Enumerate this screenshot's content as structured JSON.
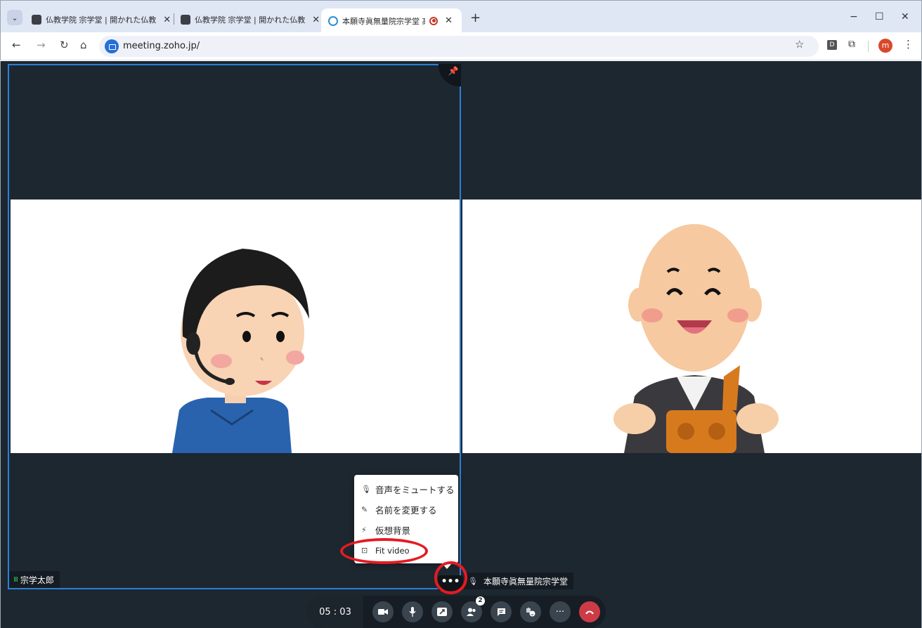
{
  "browser": {
    "tabs": [
      {
        "title": "仏教学院 宗学堂 | 開かれた仏教",
        "close": "✕",
        "active": false
      },
      {
        "title": "仏教学院 宗学堂 | 開かれた仏教",
        "close": "✕",
        "active": false
      },
      {
        "title": "本願寺眞無量院宗学堂  高",
        "close": "✕",
        "active": true
      }
    ],
    "new_tab": "+",
    "window_controls": {
      "minimize": "−",
      "maximize": "☐",
      "close": "✕"
    },
    "address": {
      "url": "meeting.zoho.jp/"
    },
    "extension_d": "D",
    "profile_initial": "m",
    "icons": {
      "back": "back-arrow-icon",
      "forward": "forward-arrow-icon",
      "reload": "reload-icon",
      "home": "home-icon",
      "star": "star-icon"
    }
  },
  "meeting": {
    "participants": [
      {
        "name": "宗学太郎",
        "speaking_indicator": "III"
      },
      {
        "name": "本願寺眞無量院宗学堂",
        "mic": "🎙"
      }
    ],
    "tile_more": "•••",
    "context_menu": [
      {
        "label": "音声をミュートする",
        "icon": "mic-icon"
      },
      {
        "label": "名前を変更する",
        "icon": "pencil-icon"
      },
      {
        "label": "仮想背景",
        "icon": "magic-wand-icon"
      },
      {
        "label": "Fit video",
        "icon": "fit-video-icon"
      }
    ],
    "toolbar": {
      "timer": "05 : 03",
      "participants_badge": "2",
      "buttons": [
        "camera-icon",
        "mic-icon",
        "share-screen-icon",
        "participants-icon",
        "chat-icon",
        "reaction-icon",
        "more-icon",
        "end-call-icon"
      ],
      "more": "···"
    }
  },
  "colors": {
    "tabbar_bg": "#dfe7f5",
    "meeting_bg": "#1d2730",
    "active_tile_border": "#2d7fd6",
    "annotation_red": "#e41b23",
    "end_call": "#cc3b46",
    "speaking_green": "#2fbf5a"
  }
}
